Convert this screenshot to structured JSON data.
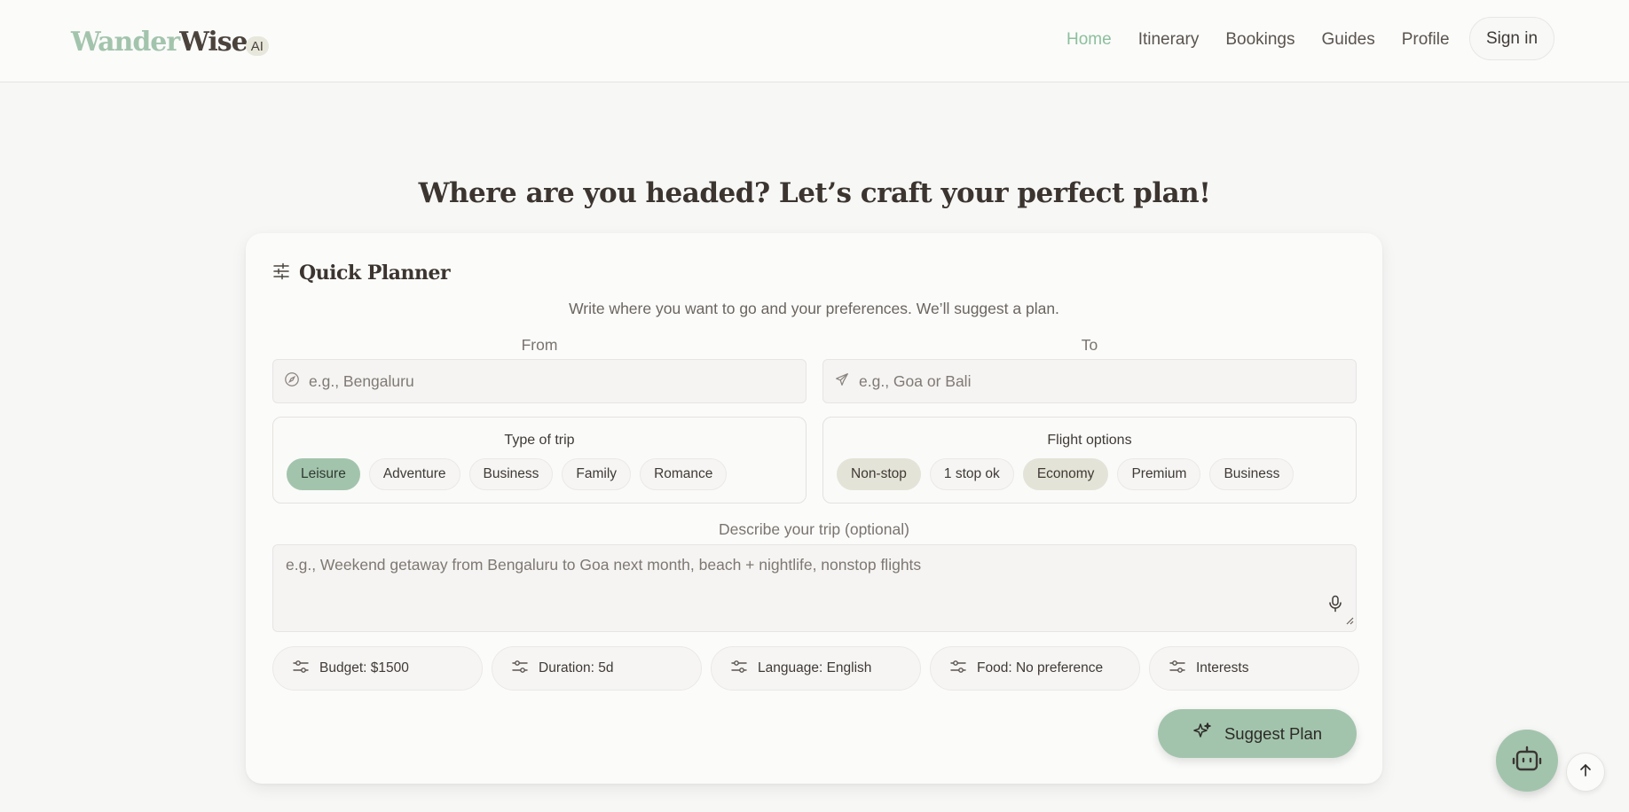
{
  "header": {
    "logo_part1": "Wander",
    "logo_part2": "Wise",
    "logo_badge": "AI",
    "nav": [
      {
        "label": "Home",
        "active": true
      },
      {
        "label": "Itinerary",
        "active": false
      },
      {
        "label": "Bookings",
        "active": false
      },
      {
        "label": "Guides",
        "active": false
      },
      {
        "label": "Profile",
        "active": false
      }
    ],
    "signin_label": "Sign in"
  },
  "headline": "Where are you headed? Let’s craft your perfect plan!",
  "planner": {
    "title": "Quick Planner",
    "title_icon": "sliders-icon",
    "subtitle": "Write where you want to go and your preferences. We’ll suggest a plan.",
    "from": {
      "label": "From",
      "placeholder": "e.g., Bengaluru",
      "value": "",
      "icon": "compass-icon"
    },
    "to": {
      "label": "To",
      "placeholder": "e.g., Goa or Bali",
      "value": "",
      "icon": "plane-icon"
    },
    "trip_type": {
      "title": "Type of trip",
      "options": [
        "Leisure",
        "Adventure",
        "Business",
        "Family",
        "Romance"
      ],
      "selected": [
        "Leisure"
      ]
    },
    "flight_options": {
      "title": "Flight options",
      "options": [
        "Non-stop",
        "1 stop ok",
        "Economy",
        "Premium",
        "Business"
      ],
      "selected": [
        "Non-stop",
        "Economy"
      ]
    },
    "description": {
      "label": "Describe your trip (optional)",
      "placeholder": "e.g., Weekend getaway from Bengaluru to Goa next month, beach + nightlife, nonstop flights",
      "value": "",
      "icon": "microphone-icon"
    },
    "preferences": [
      {
        "label": "Budget: $1500",
        "icon": "sliders-icon"
      },
      {
        "label": "Duration: 5d",
        "icon": "sliders-icon"
      },
      {
        "label": "Language: English",
        "icon": "sliders-icon"
      },
      {
        "label": "Food: No preference",
        "icon": "sliders-icon"
      },
      {
        "label": "Interests",
        "icon": "sliders-icon"
      }
    ],
    "submit_label": "Suggest Plan",
    "submit_icon": "sparkle-icon"
  },
  "floating": {
    "chatbot_icon": "robot-icon",
    "scroll_top_icon": "arrow-up-icon"
  },
  "colors": {
    "accent_green": "#a3c4ac",
    "nav_active": "#8cbf9c",
    "chip_selected_tan": "#e4e3d7",
    "background": "#f7f7f6"
  }
}
